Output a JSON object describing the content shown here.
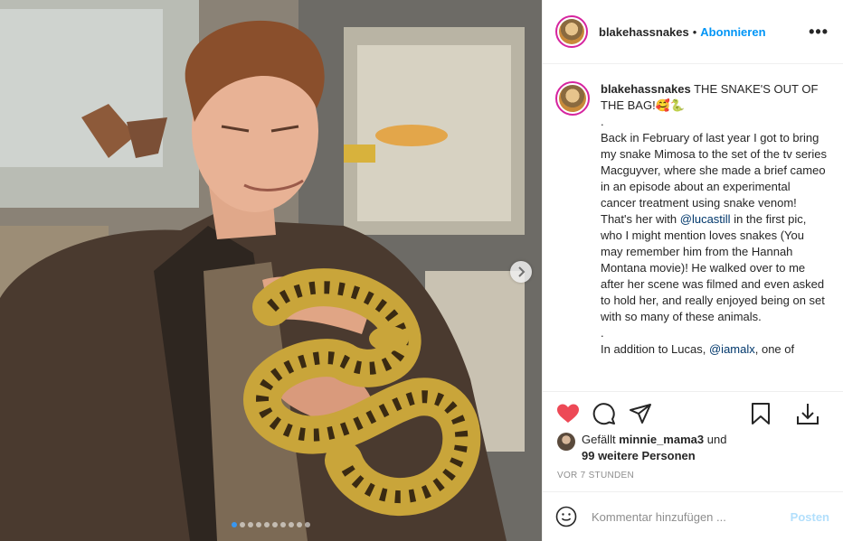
{
  "post": {
    "username": "blakehassnakes",
    "separator": "•",
    "follow_label": "Abonnieren",
    "more_icon": "more-options-icon",
    "more_label": "•••"
  },
  "caption": {
    "username": "blakehassnakes",
    "title": " THE SNAKE'S OUT OF THE BAG!🥰🐍",
    "dot1": ".",
    "body1": "Back in February of last year I got to bring my snake Mimosa to the set of the tv series Macguyver, where she made a brief cameo in an episode about an experimental cancer treatment using snake venom! That's her with ",
    "mention1": "@lucastill",
    "body2": " in the first pic, who I might mention loves snakes (You may remember him from the Hannah Montana movie)! He walked over to me after her scene was filmed and even asked to hold her, and really enjoyed being on set with so many of these animals.",
    "dot2": ".",
    "body3": "In addition to Lucas, ",
    "mention2": "@iamalx",
    "body4": ", one of"
  },
  "actions": {
    "like_icon": "heart-icon",
    "comment_icon": "comment-icon",
    "share_icon": "share-icon",
    "save_icon": "bookmark-icon",
    "download_icon": "download-icon",
    "like_color": "#ed4956"
  },
  "likes": {
    "prefix": "Gefällt ",
    "user": "minnie_mama3",
    "mid": " und",
    "others": "99 weitere Personen"
  },
  "timestamp": "VOR 7 STUNDEN",
  "comment_box": {
    "placeholder": "Kommentar hinzufügen ...",
    "post_label": "Posten"
  },
  "carousel": {
    "slide_count": 10,
    "current_index": 1
  }
}
